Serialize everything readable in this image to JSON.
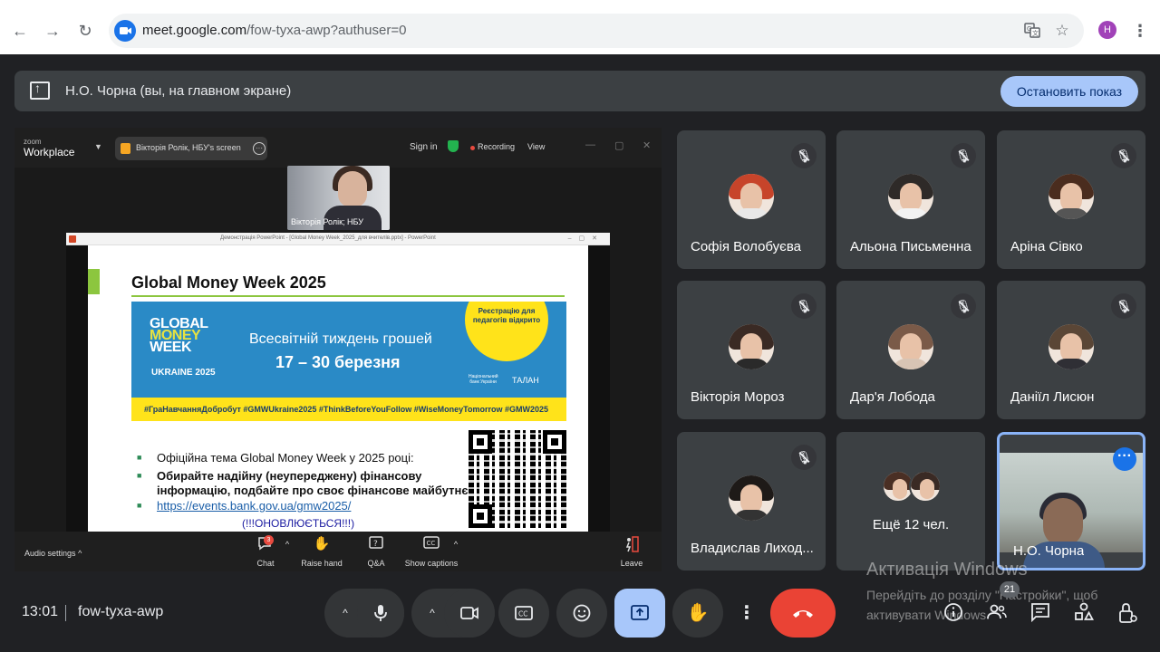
{
  "browser": {
    "url_host": "meet.google.com",
    "url_path": "/fow-tyxa-awp?authuser=0",
    "profile_initial": "H",
    "icons": [
      "back-icon",
      "forward-icon",
      "reload-icon",
      "translate-icon",
      "star-icon",
      "kebab-menu-icon"
    ]
  },
  "presenting_bar": {
    "text": "Н.О. Чорна (вы, на главном экране)",
    "stop_label": "Остановить показ"
  },
  "zoom": {
    "logo_small": "zoom",
    "logo": "Workplace",
    "share_pill": "Вікторія Ролік, НБУ's screen",
    "sign_in": "Sign in",
    "recording": "Recording",
    "view": "View",
    "presenter_label": "Вікторія Ролік; НБУ",
    "audio_settings": "Audio settings",
    "chat_badge": "3",
    "tools": [
      {
        "label": "Chat",
        "icon": "chat-icon"
      },
      {
        "label": "Raise hand",
        "icon": "raise-hand-icon"
      },
      {
        "label": "Q&A",
        "icon": "qa-icon"
      },
      {
        "label": "Show captions",
        "icon": "captions-icon"
      },
      {
        "label": "Leave",
        "icon": "leave-icon"
      }
    ]
  },
  "powerpoint": {
    "title_bar": "Демонстрація PowerPoint - [Global Money Week_2025_для вчителів.pptx] - PowerPoint"
  },
  "slide": {
    "title": "Global Money Week 2025",
    "banner_logo": [
      "GLOBAL",
      "MONEY",
      "WEEK"
    ],
    "banner_country": "UKRAINE 2025",
    "banner_line1": "Всесвітній тиждень грошей",
    "banner_line2": "17 – 30 березня",
    "circle_text": "Реєстрацію для педагогів відкрито",
    "nbu_logo": "Національний банк України",
    "talan_logo": "ТАЛАН",
    "hashtags": "#ГраНавчанняДобробут  #GMWUkraine2025  #ThinkBeforeYouFollow  #WiseMoneyTomorrow  #GMW2025",
    "bullet1": "Офіційна тема Global Money Week у 2025 році:",
    "bullet2a": "Обирайте надійну (неупереджену) фінансову",
    "bullet2b": "інформацію, подбайте про своє фінансове майбутнє",
    "bullet3": "https://events.bank.gov.ua/gmw2025/",
    "updated": "(!!!ОНОВЛЮЄТЬСЯ!!!)"
  },
  "participants": [
    {
      "name": "Софія Волобуєва",
      "hair": "#c7442a",
      "body": "#e8e8e8"
    },
    {
      "name": "Альона Письменна",
      "hair": "#2e2a28",
      "body": "#f2f2f2"
    },
    {
      "name": "Аріна Сівко",
      "hair": "#4a2c1e",
      "body": "#555555"
    },
    {
      "name": "Вікторія Мороз",
      "hair": "#3a2a24",
      "body": "#2a2a2a"
    },
    {
      "name": "Дар'я Лобода",
      "hair": "#7a5a48",
      "body": "#d8c4b4"
    },
    {
      "name": "Даніїл Лисюн",
      "hair": "#5a4636",
      "body": "#2f2f35"
    },
    {
      "name": "Владислав Лиходієнко",
      "name_display": "Владислав Лиход...",
      "hair": "#1e1a18",
      "body": "#333333"
    }
  ],
  "more_tile": {
    "label": "Ещё 12 чел."
  },
  "self_tile": {
    "name": "Н.О. Чорна"
  },
  "bottom": {
    "time": "13:01",
    "meeting_code": "fow-tyxa-awp",
    "participant_count": "21",
    "controls": [
      "mic-icon",
      "camera-icon",
      "captions-icon",
      "emoji-icon",
      "present-icon",
      "raise-hand-icon",
      "more-options-icon",
      "end-call-icon"
    ],
    "right_controls": [
      "info-icon",
      "people-icon",
      "chat-icon",
      "activities-icon",
      "host-controls-icon"
    ]
  },
  "watermark": {
    "title": "Активація Windows",
    "text": "Перейдіть до розділу \"Настройки\", щоб активувати Windows."
  },
  "colors": {
    "meet_bg": "#202124",
    "tile_bg": "#3c4043",
    "accent_blue": "#a8c7fa",
    "end_red": "#ea4335",
    "gmw_blue": "#2a8ac6",
    "gmw_yellow": "#ffe31a",
    "gmw_green": "#8cc63f"
  }
}
